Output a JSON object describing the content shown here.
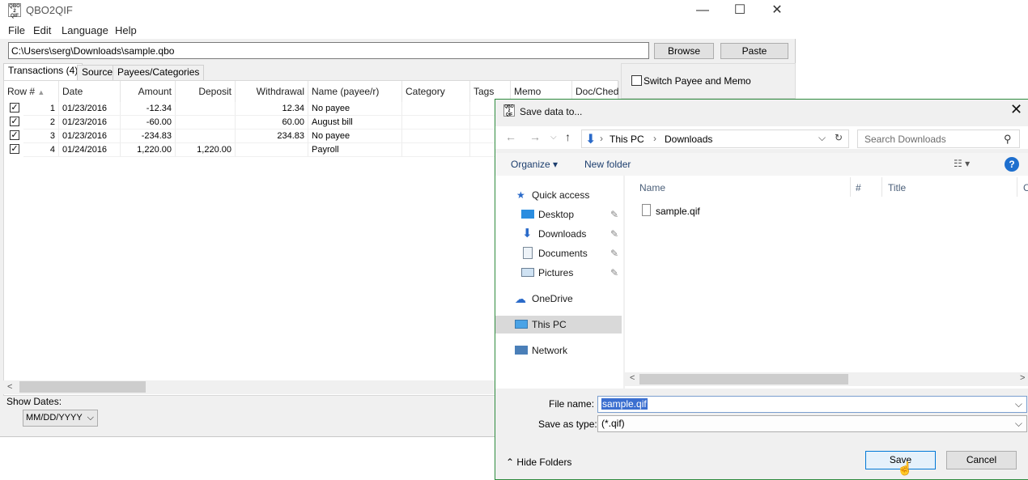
{
  "main": {
    "title": "QBO2QIF",
    "icon_text": "QBO\n2\nQIF",
    "window_controls": {
      "minimize": "—",
      "maximize": "☐",
      "close": "✕"
    },
    "menu": [
      "File",
      "Edit",
      "Language",
      "Help"
    ],
    "path_value": "C:\\Users\\serg\\Downloads\\sample.qbo",
    "browse_label": "Browse",
    "paste_label": "Paste",
    "tabs": [
      "Transactions (4)",
      "Source",
      "Payees/Categories"
    ],
    "switch_label": "Switch Payee and Memo",
    "columns": [
      "Row #",
      "Date",
      "Amount",
      "Deposit",
      "Withdrawal",
      "Name (payee/r)",
      "Category",
      "Tags",
      "Memo",
      "Doc/Ched"
    ],
    "rows": [
      {
        "n": "1",
        "date": "01/23/2016",
        "amount": "-12.34",
        "deposit": "",
        "withdrawal": "12.34",
        "name": "No payee"
      },
      {
        "n": "2",
        "date": "01/23/2016",
        "amount": "-60.00",
        "deposit": "",
        "withdrawal": "60.00",
        "name": "August bill"
      },
      {
        "n": "3",
        "date": "01/23/2016",
        "amount": "-234.83",
        "deposit": "",
        "withdrawal": "234.83",
        "name": "No payee"
      },
      {
        "n": "4",
        "date": "01/24/2016",
        "amount": "1,220.00",
        "deposit": "1,220.00",
        "withdrawal": "",
        "name": "Payroll"
      }
    ],
    "show_dates_label": "Show Dates:",
    "date_format": "MM/DD/YYYY"
  },
  "dialog": {
    "title": "Save data to...",
    "breadcrumb": [
      "This PC",
      "Downloads"
    ],
    "search_placeholder": "Search Downloads",
    "organize_label": "Organize",
    "new_folder_label": "New folder",
    "nav_items": [
      {
        "label": "Quick access",
        "icon": "star-icon"
      },
      {
        "label": "Desktop",
        "icon": "desktop-icon"
      },
      {
        "label": "Downloads",
        "icon": "download-icon"
      },
      {
        "label": "Documents",
        "icon": "document-icon"
      },
      {
        "label": "Pictures",
        "icon": "pictures-icon"
      },
      {
        "label": "OneDrive",
        "icon": "cloud-icon"
      },
      {
        "label": "This PC",
        "icon": "computer-icon"
      },
      {
        "label": "Network",
        "icon": "network-icon"
      }
    ],
    "columns": [
      "Name",
      "#",
      "Title",
      "Co"
    ],
    "files": [
      "sample.qif"
    ],
    "file_name_label": "File name:",
    "file_name_value": "sample.qif",
    "save_type_label": "Save as type:",
    "save_type_value": "(*.qif)",
    "hide_folders_label": "Hide Folders",
    "save_label": "Save",
    "cancel_label": "Cancel"
  }
}
